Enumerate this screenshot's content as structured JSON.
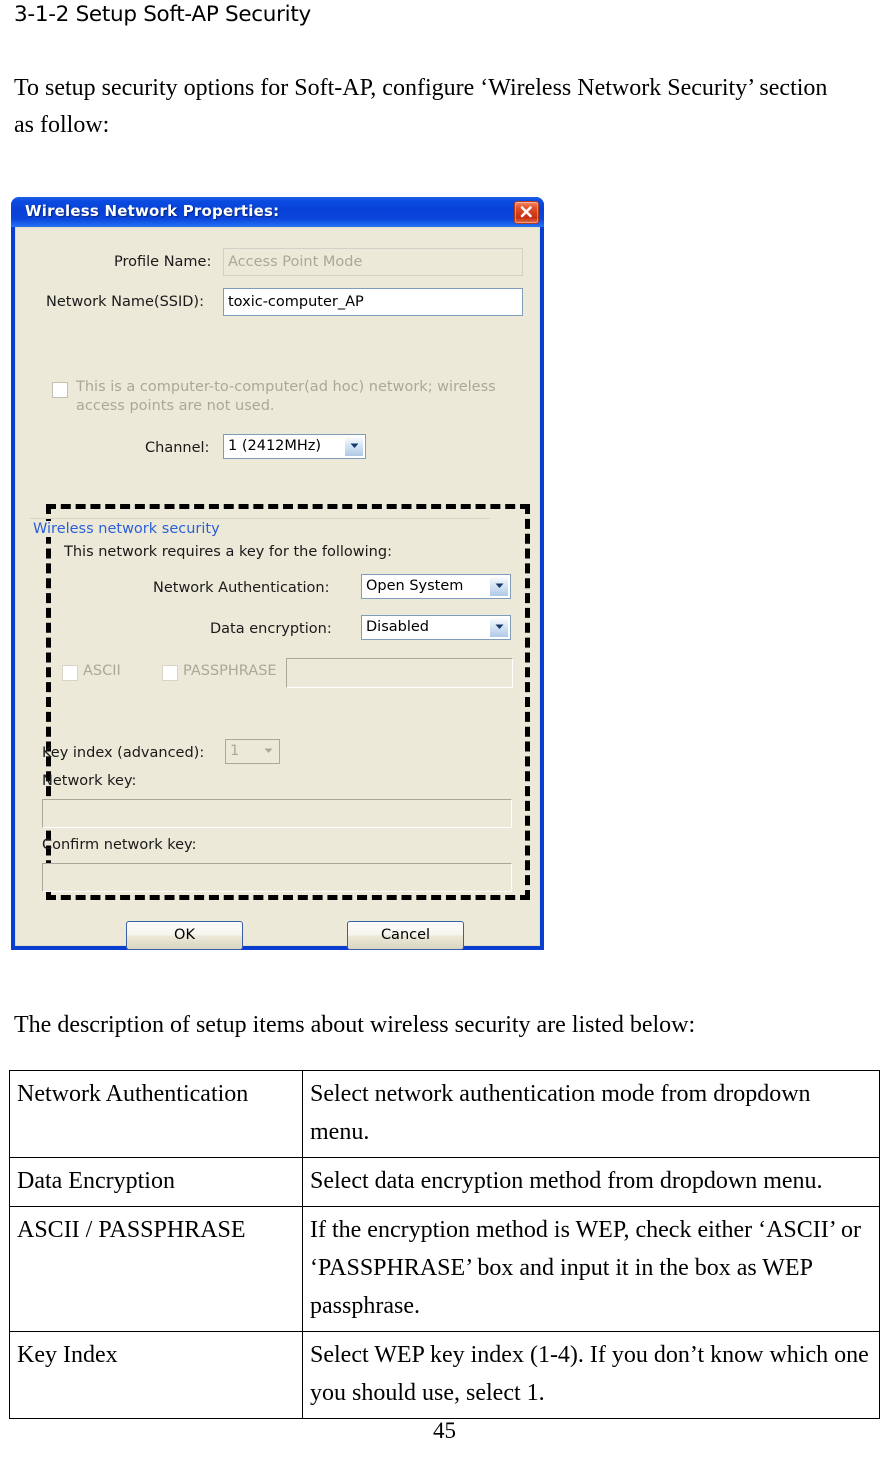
{
  "document": {
    "heading": "3-1-2 Setup Soft-AP Security",
    "intro_paragraph": "To setup security options for Soft-AP, configure ‘Wireless Network Security’ section as follow:",
    "description_paragraph": "The description of setup items about wireless security are listed below:",
    "page_number": "45"
  },
  "dialog": {
    "title": "Wireless Network Properties:",
    "close_label": "Close",
    "fields": {
      "profile_name_label": "Profile Name:",
      "profile_name_value": "Access Point Mode",
      "ssid_label": "Network Name(SSID):",
      "ssid_value": "toxic-computer_AP",
      "adhoc_checkbox_label": "This is a computer-to-computer(ad hoc) network; wireless access points are not used.",
      "channel_label": "Channel:",
      "channel_value": "1  (2412MHz)"
    },
    "security_group": {
      "title": "Wireless network security",
      "requires_key_text": "This network requires a key for the following:",
      "network_auth_label": "Network Authentication:",
      "network_auth_value": "Open System",
      "data_encryption_label": "Data encryption:",
      "data_encryption_value": "Disabled",
      "ascii_label": "ASCII",
      "passphrase_label": "PASSPHRASE",
      "key_input_value": "",
      "key_index_label": "Key index (advanced):",
      "key_index_value": "1",
      "network_key_label": "Network key:",
      "network_key_value": "",
      "confirm_key_label": "Confirm network key:",
      "confirm_key_value": ""
    },
    "buttons": {
      "ok": "OK",
      "cancel": "Cancel"
    },
    "colors": {
      "titlebar_blue": "#0A3ED0",
      "face": "#ECE9D8",
      "group_title_blue": "#2B5FD9",
      "close_red": "#C62E10"
    }
  },
  "description_table": {
    "rows": [
      {
        "item": "Network Authentication",
        "description": "Select network authentication mode from dropdown menu."
      },
      {
        "item": "Data Encryption",
        "description": "Select data encryption method from dropdown menu."
      },
      {
        "item": "ASCII / PASSPHRASE",
        "description": "If the encryption method is WEP, check either ‘ASCII’ or ‘PASSPHRASE’ box and input it in the box as WEP passphrase."
      },
      {
        "item": "Key Index",
        "description": "Select WEP key index (1-4). If you don’t know which one you should use, select 1."
      }
    ]
  }
}
